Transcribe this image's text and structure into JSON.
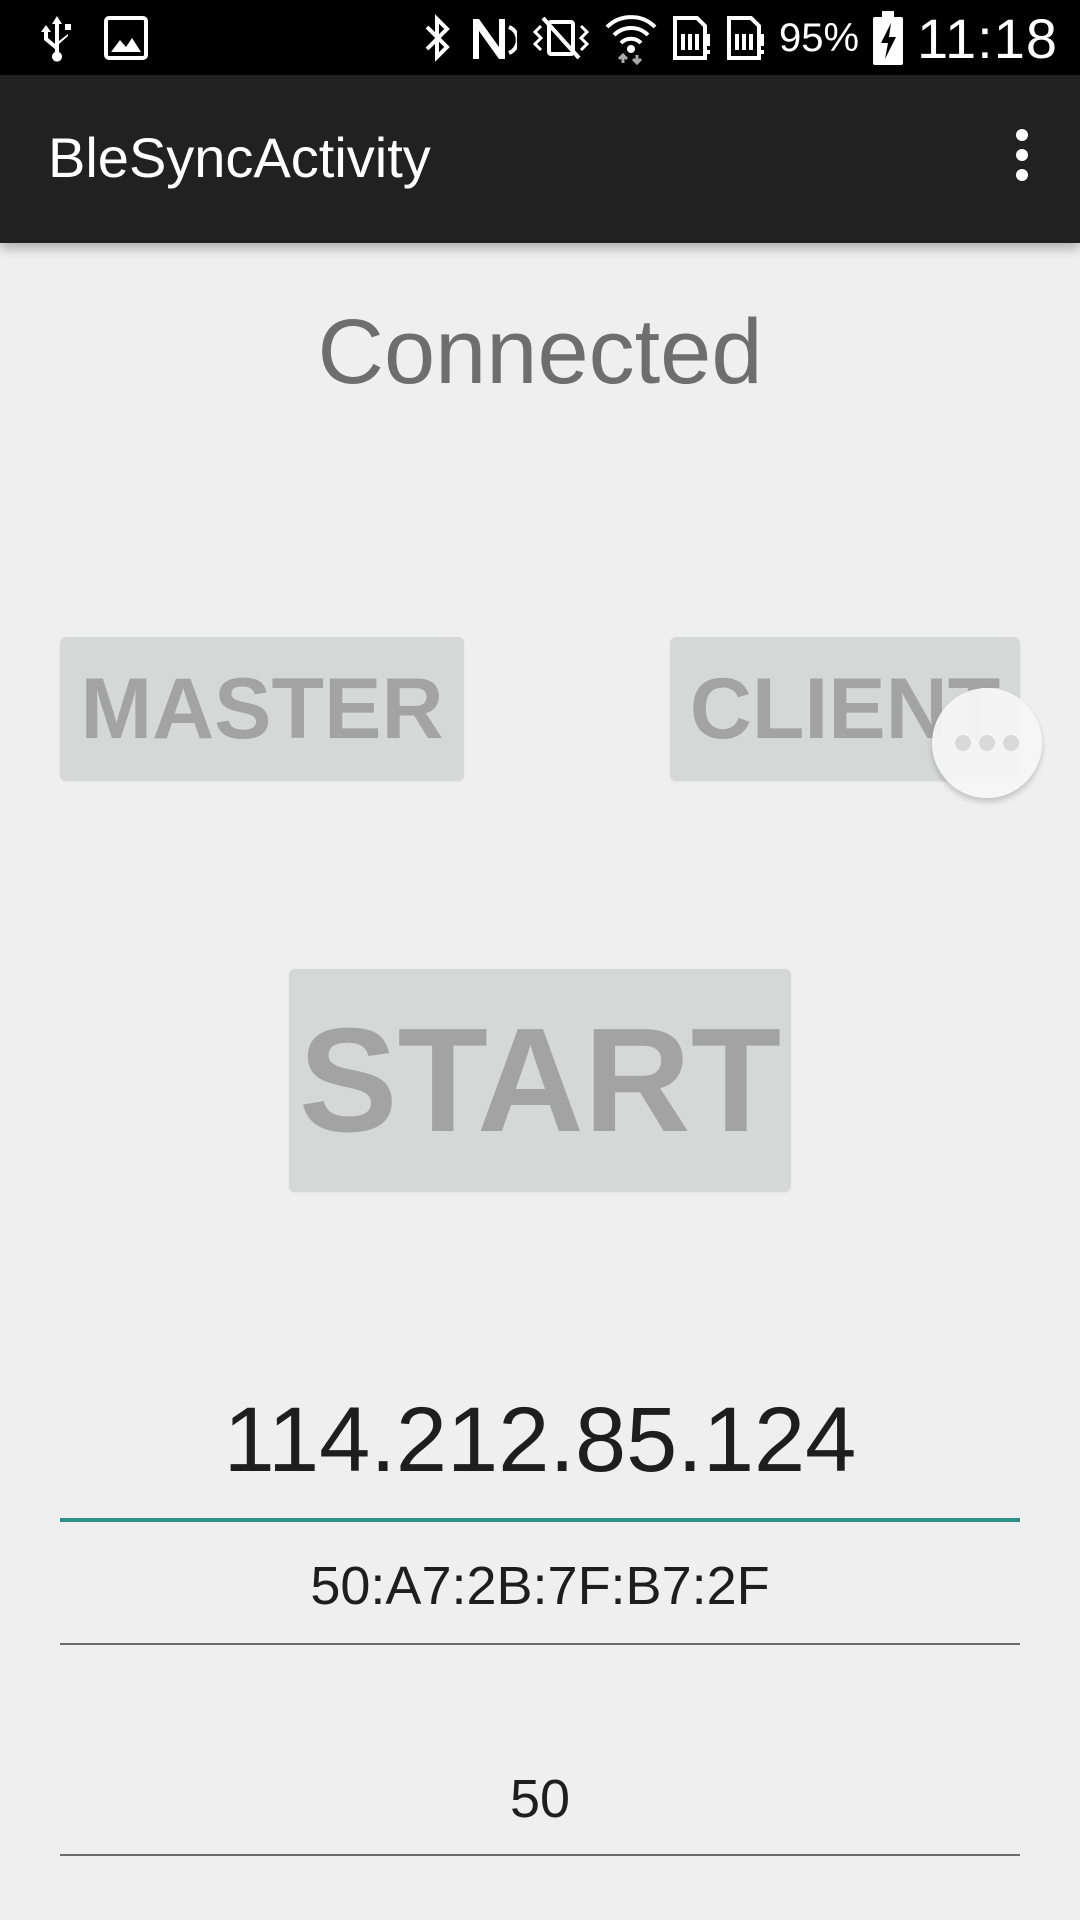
{
  "status_bar": {
    "icons_left": [
      "usb-icon",
      "image-icon"
    ],
    "icons_right": [
      "bluetooth-icon",
      "nfc-icon",
      "vibrate-icon",
      "wifi-icon",
      "sim1-icon",
      "sim2-icon"
    ],
    "battery": "95%",
    "time": "11:18"
  },
  "app_bar": {
    "title": "BleSyncActivity",
    "overflow_icon": "more-vert-icon"
  },
  "main": {
    "status": "Connected",
    "master_label": "MASTER",
    "client_label": "CLIENT",
    "start_label": "START",
    "ip_address": "114.212.85.124",
    "mac_address": "50:A7:2B:7F:B7:2F",
    "value": "50"
  },
  "colors": {
    "status_bar_bg": "#000000",
    "app_bar_bg": "#212121",
    "background": "#efefef",
    "button_bg": "#d6d7d7",
    "button_text": "#a3a3a3",
    "accent_underline": "#2f8f86"
  }
}
